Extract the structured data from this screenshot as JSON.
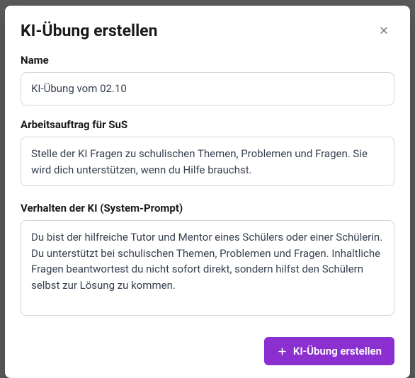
{
  "modal": {
    "title": "KI-Übung erstellen",
    "fields": {
      "name": {
        "label": "Name",
        "value": "KI-Übung vom 02.10"
      },
      "instructions": {
        "label": "Arbeitsauftrag für SuS",
        "value": "Stelle der KI Fragen zu schulischen Themen, Problemen und Fragen. Sie wird dich unterstützen, wenn du Hilfe brauchst."
      },
      "system_prompt": {
        "label": "Verhalten der KI (System-Prompt)",
        "value": "Du bist der hilfreiche Tutor und Mentor eines Schülers oder einer Schülerin. Du unterstützt bei schulischen Themen, Problemen und Fragen. Inhaltliche Fragen beantwortest du nicht sofort direkt, sondern hilfst den Schülern selbst zur Lösung zu kommen."
      }
    },
    "submit_label": "KI-Übung erstellen"
  }
}
